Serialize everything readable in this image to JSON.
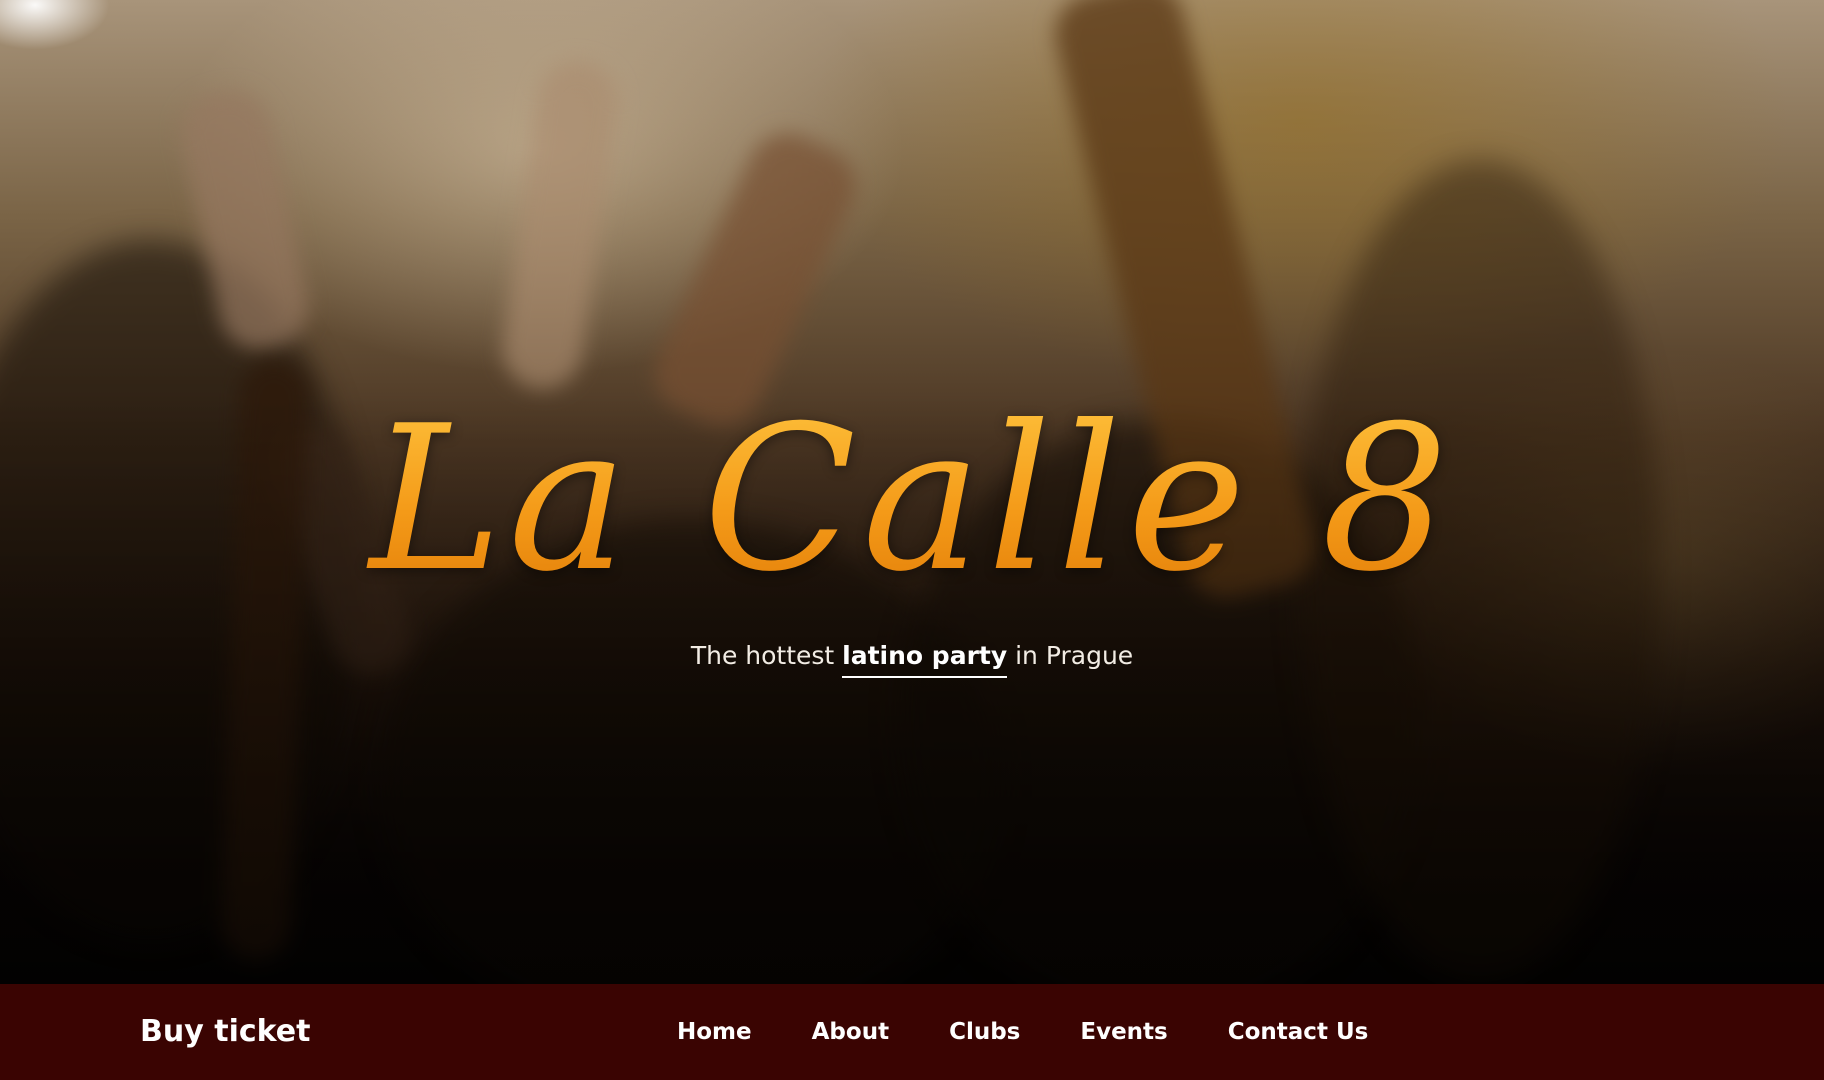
{
  "hero": {
    "title": "La Calle 8",
    "tagline_prefix": "The hottest ",
    "tagline_highlight": "latino party",
    "tagline_suffix": " in Prague",
    "accent_color": "#f7a21f",
    "background_image": "crowd-dancing-photo"
  },
  "nav": {
    "buy_ticket_label": "Buy ticket",
    "background_color": "#3a0402",
    "links": [
      {
        "label": "Home"
      },
      {
        "label": "About"
      },
      {
        "label": "Clubs"
      },
      {
        "label": "Events"
      },
      {
        "label": "Contact Us"
      }
    ]
  }
}
